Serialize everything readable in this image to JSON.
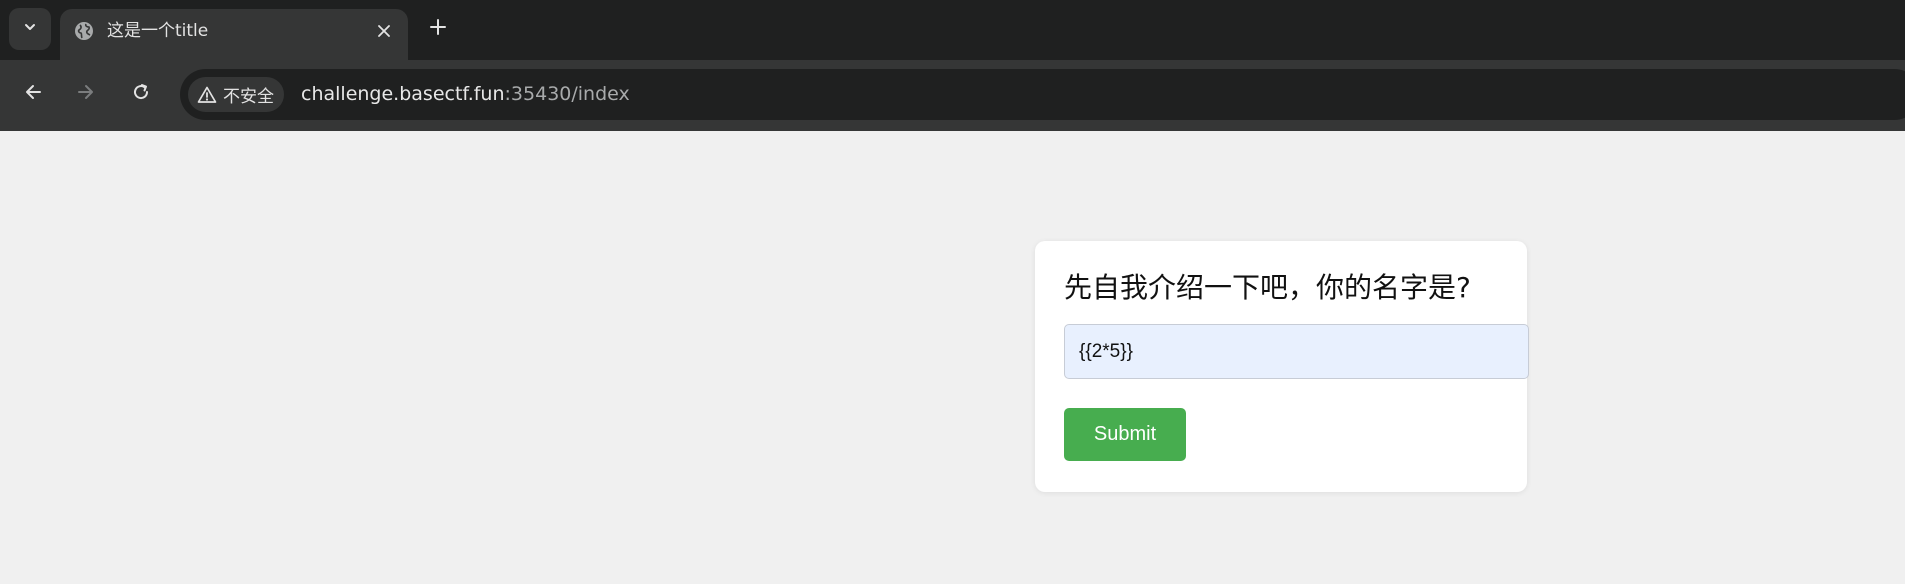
{
  "browser": {
    "tab": {
      "title": "这是一个title",
      "favicon": "globe-icon"
    },
    "tab_search_icon": "chevron-down-icon",
    "new_tab_icon": "plus-icon",
    "toolbar": {
      "back_icon": "arrow-left-icon",
      "forward_icon": "arrow-right-icon",
      "reload_icon": "reload-icon"
    },
    "omnibox": {
      "security_label": "不安全",
      "security_icon": "warning-triangle-icon",
      "url_host": "challenge.basectf.fun",
      "url_rest": ":35430/index"
    },
    "colors": {
      "tabstrip_bg": "#1f2020",
      "toolbar_bg": "#353636",
      "page_bg": "#f0f0f0"
    }
  },
  "page": {
    "heading": "先自我介绍一下吧，你的名字是?",
    "name_input": {
      "value": "{{2*5}}"
    },
    "submit_label": "Submit",
    "colors": {
      "submit_bg": "#47ad4f",
      "input_bg": "#e8f0fe",
      "card_bg": "#ffffff"
    }
  }
}
